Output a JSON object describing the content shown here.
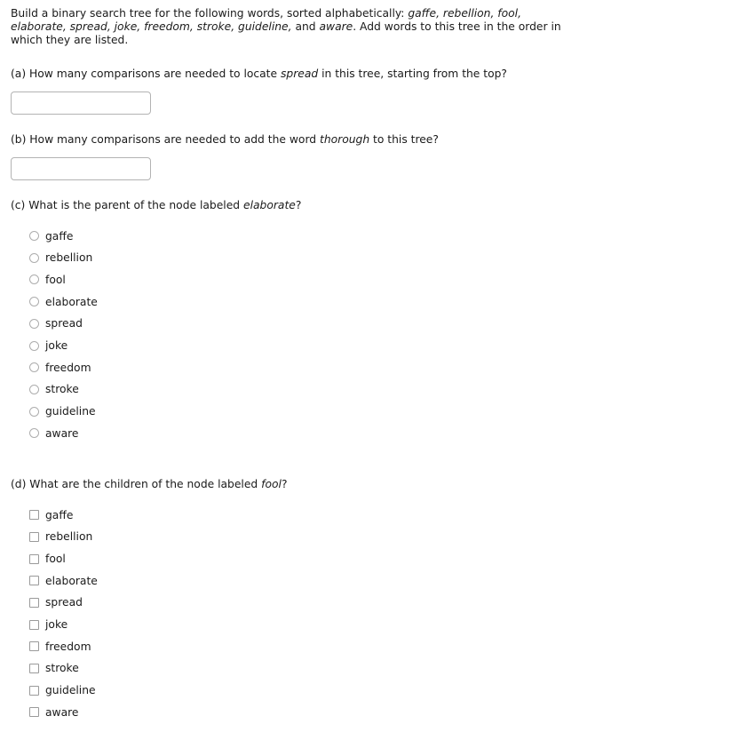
{
  "intro": {
    "segments": [
      {
        "text": "Build a binary search tree for the following words, sorted alphabetically: ",
        "italic": false
      },
      {
        "text": "gaffe, rebellion, fool, elaborate, spread, joke, freedom, stroke, guideline,",
        "italic": true
      },
      {
        "text": " and ",
        "italic": false
      },
      {
        "text": "aware",
        "italic": true
      },
      {
        "text": ". Add words to this tree in the order in which they are listed.",
        "italic": false
      }
    ]
  },
  "questions": {
    "a": {
      "segments": [
        {
          "text": "(a) How many comparisons are needed to locate ",
          "italic": false
        },
        {
          "text": "spread",
          "italic": true
        },
        {
          "text": " in this tree, starting from the top?",
          "italic": false
        }
      ],
      "input_value": "",
      "input_placeholder": ""
    },
    "b": {
      "segments": [
        {
          "text": "(b) How many comparisons are needed to add the word ",
          "italic": false
        },
        {
          "text": "thorough",
          "italic": true
        },
        {
          "text": " to this tree?",
          "italic": false
        }
      ],
      "input_value": "",
      "input_placeholder": ""
    },
    "c": {
      "segments": [
        {
          "text": "(c) What is the parent of the node labeled ",
          "italic": false
        },
        {
          "text": "elaborate",
          "italic": true
        },
        {
          "text": "?",
          "italic": false
        }
      ],
      "control": "radio",
      "options": [
        {
          "label": "gaffe",
          "checked": false
        },
        {
          "label": "rebellion",
          "checked": false
        },
        {
          "label": "fool",
          "checked": false
        },
        {
          "label": "elaborate",
          "checked": false
        },
        {
          "label": "spread",
          "checked": false
        },
        {
          "label": "joke",
          "checked": false
        },
        {
          "label": "freedom",
          "checked": false
        },
        {
          "label": "stroke",
          "checked": false
        },
        {
          "label": "guideline",
          "checked": false
        },
        {
          "label": "aware",
          "checked": false
        }
      ]
    },
    "d": {
      "segments": [
        {
          "text": "(d) What are the children of the node labeled ",
          "italic": false
        },
        {
          "text": "fool",
          "italic": true
        },
        {
          "text": "?",
          "italic": false
        }
      ],
      "control": "checkbox",
      "options": [
        {
          "label": "gaffe",
          "checked": false
        },
        {
          "label": "rebellion",
          "checked": false
        },
        {
          "label": "fool",
          "checked": false
        },
        {
          "label": "elaborate",
          "checked": false
        },
        {
          "label": "spread",
          "checked": false
        },
        {
          "label": "joke",
          "checked": false
        },
        {
          "label": "freedom",
          "checked": false
        },
        {
          "label": "stroke",
          "checked": false
        },
        {
          "label": "guideline",
          "checked": false
        },
        {
          "label": "aware",
          "checked": false
        }
      ]
    }
  },
  "colors": {
    "text": "#1a1a1a",
    "input_border": "#b3b3b3",
    "control_border": "#adadad",
    "background": "#ffffff"
  }
}
